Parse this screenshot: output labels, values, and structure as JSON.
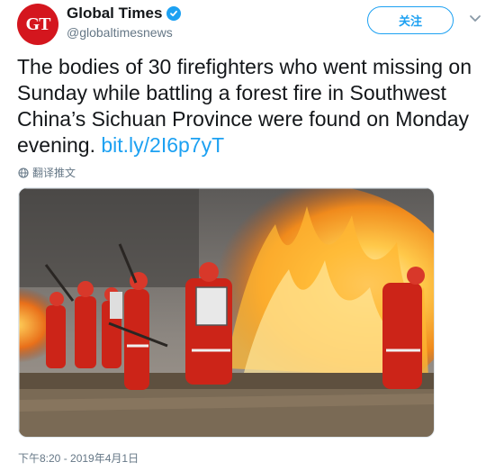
{
  "account": {
    "avatar_text": "GT",
    "display_name": "Global Times",
    "handle": "@globaltimesnews",
    "verified_icon": "verified-badge-icon"
  },
  "follow_label": "关注",
  "tweet": {
    "text": "The bodies of 30 firefighters who went missing on Sunday while battling a forest fire in Southwest China’s Sichuan Province were found on Monday evening. ",
    "link": "bit.ly/2I6p7yT"
  },
  "translate_label": "翻译推文",
  "timestamp": "下午8:20 - 2019年4月1日",
  "colors": {
    "accent": "#1da1f2",
    "avatar": "#d4161e",
    "secondary_text": "#657786"
  }
}
